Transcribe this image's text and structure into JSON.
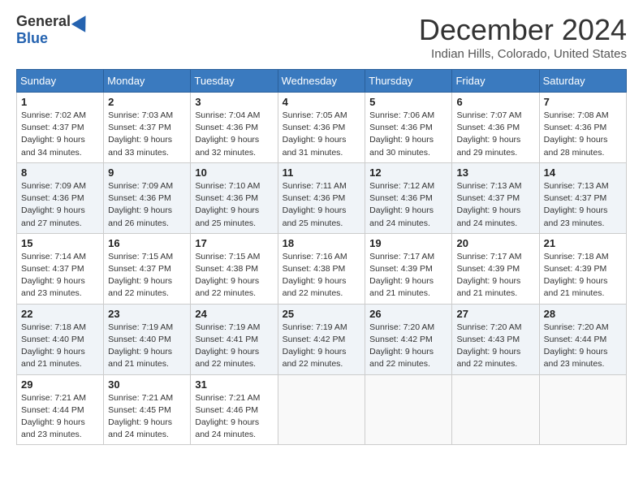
{
  "logo": {
    "general": "General",
    "blue": "Blue"
  },
  "header": {
    "month": "December 2024",
    "location": "Indian Hills, Colorado, United States"
  },
  "days_of_week": [
    "Sunday",
    "Monday",
    "Tuesday",
    "Wednesday",
    "Thursday",
    "Friday",
    "Saturday"
  ],
  "weeks": [
    [
      {
        "day": "1",
        "sunrise": "7:02 AM",
        "sunset": "4:37 PM",
        "daylight": "9 hours and 34 minutes."
      },
      {
        "day": "2",
        "sunrise": "7:03 AM",
        "sunset": "4:37 PM",
        "daylight": "9 hours and 33 minutes."
      },
      {
        "day": "3",
        "sunrise": "7:04 AM",
        "sunset": "4:36 PM",
        "daylight": "9 hours and 32 minutes."
      },
      {
        "day": "4",
        "sunrise": "7:05 AM",
        "sunset": "4:36 PM",
        "daylight": "9 hours and 31 minutes."
      },
      {
        "day": "5",
        "sunrise": "7:06 AM",
        "sunset": "4:36 PM",
        "daylight": "9 hours and 30 minutes."
      },
      {
        "day": "6",
        "sunrise": "7:07 AM",
        "sunset": "4:36 PM",
        "daylight": "9 hours and 29 minutes."
      },
      {
        "day": "7",
        "sunrise": "7:08 AM",
        "sunset": "4:36 PM",
        "daylight": "9 hours and 28 minutes."
      }
    ],
    [
      {
        "day": "8",
        "sunrise": "7:09 AM",
        "sunset": "4:36 PM",
        "daylight": "9 hours and 27 minutes."
      },
      {
        "day": "9",
        "sunrise": "7:09 AM",
        "sunset": "4:36 PM",
        "daylight": "9 hours and 26 minutes."
      },
      {
        "day": "10",
        "sunrise": "7:10 AM",
        "sunset": "4:36 PM",
        "daylight": "9 hours and 25 minutes."
      },
      {
        "day": "11",
        "sunrise": "7:11 AM",
        "sunset": "4:36 PM",
        "daylight": "9 hours and 25 minutes."
      },
      {
        "day": "12",
        "sunrise": "7:12 AM",
        "sunset": "4:36 PM",
        "daylight": "9 hours and 24 minutes."
      },
      {
        "day": "13",
        "sunrise": "7:13 AM",
        "sunset": "4:37 PM",
        "daylight": "9 hours and 24 minutes."
      },
      {
        "day": "14",
        "sunrise": "7:13 AM",
        "sunset": "4:37 PM",
        "daylight": "9 hours and 23 minutes."
      }
    ],
    [
      {
        "day": "15",
        "sunrise": "7:14 AM",
        "sunset": "4:37 PM",
        "daylight": "9 hours and 23 minutes."
      },
      {
        "day": "16",
        "sunrise": "7:15 AM",
        "sunset": "4:37 PM",
        "daylight": "9 hours and 22 minutes."
      },
      {
        "day": "17",
        "sunrise": "7:15 AM",
        "sunset": "4:38 PM",
        "daylight": "9 hours and 22 minutes."
      },
      {
        "day": "18",
        "sunrise": "7:16 AM",
        "sunset": "4:38 PM",
        "daylight": "9 hours and 22 minutes."
      },
      {
        "day": "19",
        "sunrise": "7:17 AM",
        "sunset": "4:39 PM",
        "daylight": "9 hours and 21 minutes."
      },
      {
        "day": "20",
        "sunrise": "7:17 AM",
        "sunset": "4:39 PM",
        "daylight": "9 hours and 21 minutes."
      },
      {
        "day": "21",
        "sunrise": "7:18 AM",
        "sunset": "4:39 PM",
        "daylight": "9 hours and 21 minutes."
      }
    ],
    [
      {
        "day": "22",
        "sunrise": "7:18 AM",
        "sunset": "4:40 PM",
        "daylight": "9 hours and 21 minutes."
      },
      {
        "day": "23",
        "sunrise": "7:19 AM",
        "sunset": "4:40 PM",
        "daylight": "9 hours and 21 minutes."
      },
      {
        "day": "24",
        "sunrise": "7:19 AM",
        "sunset": "4:41 PM",
        "daylight": "9 hours and 22 minutes."
      },
      {
        "day": "25",
        "sunrise": "7:19 AM",
        "sunset": "4:42 PM",
        "daylight": "9 hours and 22 minutes."
      },
      {
        "day": "26",
        "sunrise": "7:20 AM",
        "sunset": "4:42 PM",
        "daylight": "9 hours and 22 minutes."
      },
      {
        "day": "27",
        "sunrise": "7:20 AM",
        "sunset": "4:43 PM",
        "daylight": "9 hours and 22 minutes."
      },
      {
        "day": "28",
        "sunrise": "7:20 AM",
        "sunset": "4:44 PM",
        "daylight": "9 hours and 23 minutes."
      }
    ],
    [
      {
        "day": "29",
        "sunrise": "7:21 AM",
        "sunset": "4:44 PM",
        "daylight": "9 hours and 23 minutes."
      },
      {
        "day": "30",
        "sunrise": "7:21 AM",
        "sunset": "4:45 PM",
        "daylight": "9 hours and 24 minutes."
      },
      {
        "day": "31",
        "sunrise": "7:21 AM",
        "sunset": "4:46 PM",
        "daylight": "9 hours and 24 minutes."
      },
      null,
      null,
      null,
      null
    ]
  ],
  "labels": {
    "sunrise": "Sunrise:",
    "sunset": "Sunset:",
    "daylight": "Daylight:"
  }
}
